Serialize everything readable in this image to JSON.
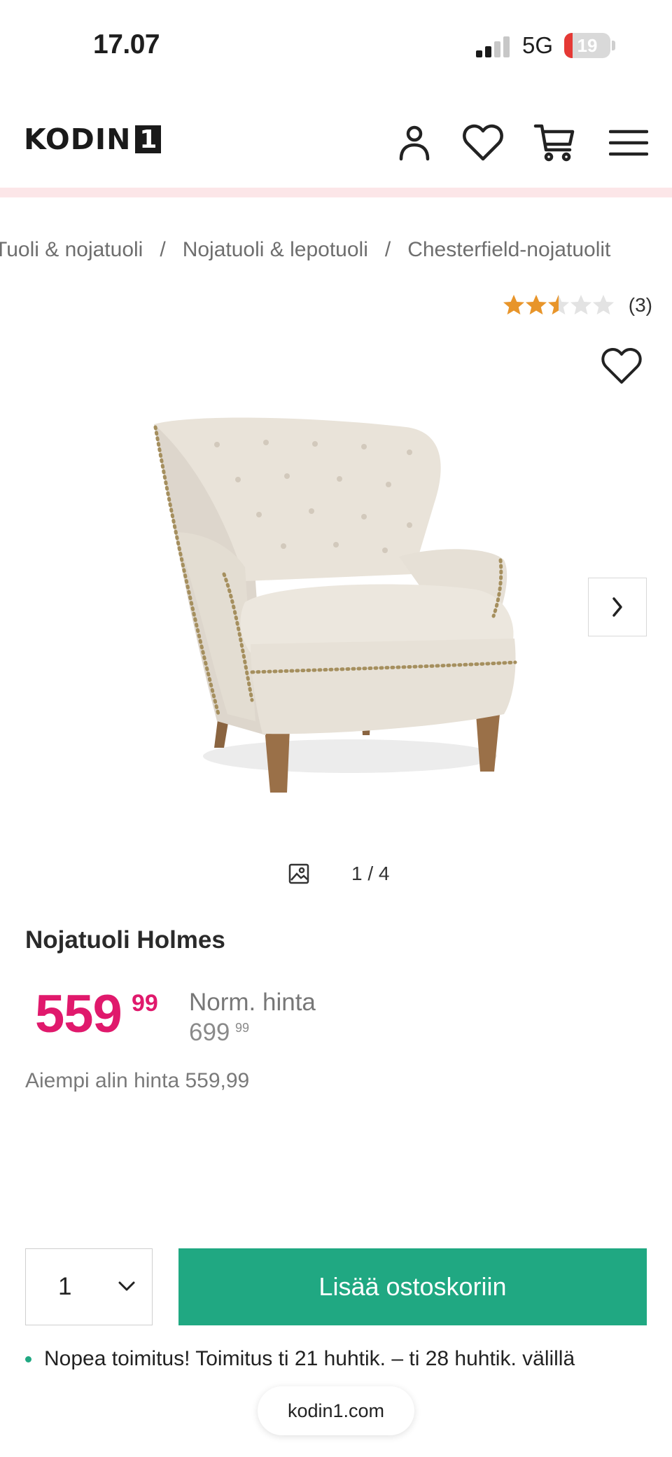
{
  "status_bar": {
    "time": "17.07",
    "network": "5G",
    "battery": "19"
  },
  "header": {
    "logo_text": "KODIN",
    "logo_number": "1",
    "icons": [
      "account-icon",
      "wishlist-heart-icon",
      "cart-icon",
      "menu-icon"
    ]
  },
  "breadcrumb": {
    "items": [
      {
        "label": "Tuoli & nojatuoli"
      },
      {
        "label": "Nojatuoli & lepotuoli"
      },
      {
        "label": "Chesterfield-nojatuolit"
      }
    ],
    "separator": "/"
  },
  "rating": {
    "stars_filled": 2.5,
    "stars_total": 5,
    "count": "(3)",
    "star_color": "#e8952a"
  },
  "gallery": {
    "counter": "1 / 4"
  },
  "product": {
    "name": "Nojatuoli Holmes",
    "price_main": "559",
    "price_cents": "99",
    "norm_label": "Norm. hinta",
    "norm_price": "699",
    "norm_cents": "99",
    "lowest_price": "Aiempi alin hinta 559,99",
    "price_color": "#e0196c"
  },
  "cart": {
    "quantity": "1",
    "add_label": "Lisää ostoskoriin",
    "button_color": "#20a882"
  },
  "delivery": {
    "text": "Nopea toimitus! Toimitus ti 21 huhtik. – ti 28 huhtik. välillä"
  },
  "browser": {
    "url": "kodin1.com"
  }
}
